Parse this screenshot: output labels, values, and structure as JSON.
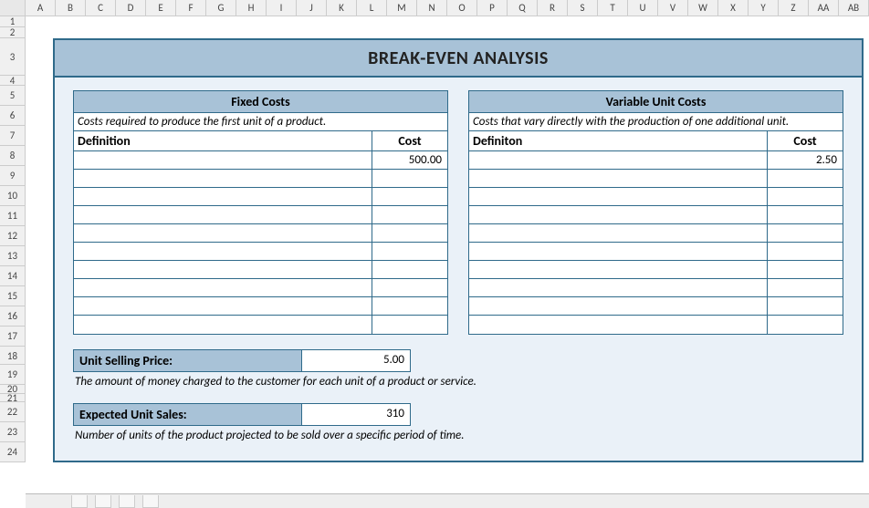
{
  "columns": [
    "A",
    "B",
    "C",
    "D",
    "E",
    "F",
    "G",
    "H",
    "I",
    "J",
    "K",
    "L",
    "M",
    "N",
    "O",
    "P",
    "Q",
    "R",
    "S",
    "T",
    "U",
    "V",
    "W",
    "X",
    "Y",
    "Z",
    "AA",
    "AB"
  ],
  "rows": [
    "1",
    "2",
    "3",
    "4",
    "5",
    "6",
    "7",
    "8",
    "9",
    "10",
    "11",
    "12",
    "13",
    "14",
    "15",
    "16",
    "17",
    "18",
    "19",
    "20",
    "21",
    "22",
    "23",
    "24"
  ],
  "title": "BREAK-EVEN ANALYSIS",
  "fixed": {
    "header": "Fixed Costs",
    "description": "Costs required to produce the first unit of a product.",
    "col_def": "Definition",
    "col_cost": "Cost",
    "rows": [
      {
        "def": "",
        "cost": "500.00"
      },
      {
        "def": "",
        "cost": ""
      },
      {
        "def": "",
        "cost": ""
      },
      {
        "def": "",
        "cost": ""
      },
      {
        "def": "",
        "cost": ""
      },
      {
        "def": "",
        "cost": ""
      },
      {
        "def": "",
        "cost": ""
      },
      {
        "def": "",
        "cost": ""
      },
      {
        "def": "",
        "cost": ""
      },
      {
        "def": "",
        "cost": ""
      }
    ]
  },
  "variable": {
    "header": "Variable Unit Costs",
    "description": "Costs that vary directly with the production of one additional unit.",
    "col_def": "Definiton",
    "col_cost": "Cost",
    "rows": [
      {
        "def": "",
        "cost": "2.50"
      },
      {
        "def": "",
        "cost": ""
      },
      {
        "def": "",
        "cost": ""
      },
      {
        "def": "",
        "cost": ""
      },
      {
        "def": "",
        "cost": ""
      },
      {
        "def": "",
        "cost": ""
      },
      {
        "def": "",
        "cost": ""
      },
      {
        "def": "",
        "cost": ""
      },
      {
        "def": "",
        "cost": ""
      },
      {
        "def": "",
        "cost": ""
      }
    ]
  },
  "selling_price": {
    "label": "Unit Selling Price:",
    "value": "5.00",
    "description": "The amount of money charged to the customer for each unit of a product or service."
  },
  "expected_sales": {
    "label": "Expected Unit Sales:",
    "value": "310",
    "description": "Number of units of the product projected to be sold over a specific period of time."
  },
  "tabs": [
    "",
    "",
    "",
    ""
  ]
}
